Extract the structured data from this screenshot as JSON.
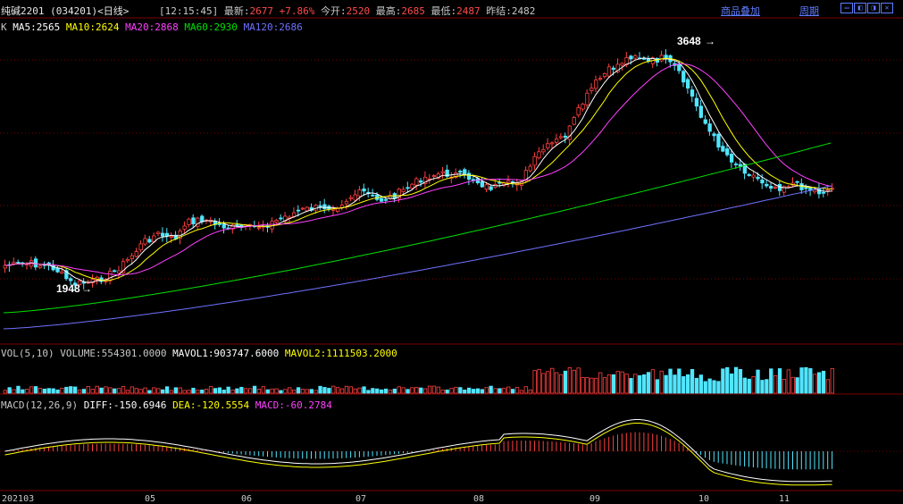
{
  "header": {
    "symbol": "纯碱2201 (034201)<日线>",
    "time": "[12:15:45]",
    "latest_label": "最新:",
    "latest": "2677",
    "change": "+7.86%",
    "open_label": "今开:",
    "open": "2520",
    "high_label": "最高:",
    "high": "2685",
    "low_label": "最低:",
    "low": "2487",
    "prev_close_label": "昨结:",
    "prev_close": "2482",
    "overlay_link": "商品叠加",
    "period_link": "周期"
  },
  "ma_legend": {
    "k": "K",
    "ma5": "MA5:2565",
    "ma10": "MA10:2624",
    "ma20": "MA20:2868",
    "ma60": "MA60:2930",
    "ma120": "MA120:2686"
  },
  "vol_legend": {
    "vol": "VOL(5,10)",
    "volume": "VOLUME:554301.0000",
    "mavol1": "MAVOL1:903747.6000",
    "mavol2": "MAVOL2:1111503.2000"
  },
  "macd_legend": {
    "macd": "MACD(12,26,9)",
    "diff": "DIFF:-150.6946",
    "dea": "DEA:-120.5554",
    "macdv": "MACD:-60.2784"
  },
  "annotations": {
    "high_mark": "3648",
    "low_mark": "1948"
  },
  "colors": {
    "up": "#ff4040",
    "down": "#50e6ff",
    "ma5": "#ffffff",
    "ma10": "#ffff00",
    "ma20": "#ff40ff",
    "ma60": "#00e000",
    "ma120": "#7070ff",
    "grid": "#7a0000"
  },
  "chart_data": {
    "type": "candlestick",
    "x_ticks": [
      "202103",
      "05",
      "06",
      "07",
      "08",
      "09",
      "10",
      "11"
    ],
    "price_high_label": "3648",
    "price_low_label": "1948",
    "last_close": 2677
  }
}
